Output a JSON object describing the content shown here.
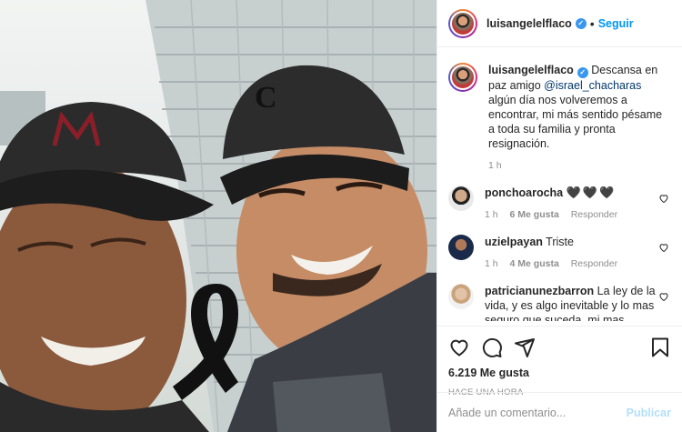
{
  "header": {
    "username": "luisangelelflaco",
    "dot": "•",
    "follow_label": "Seguir",
    "more_label": "···"
  },
  "caption": {
    "username": "luisangelelflaco",
    "text_before": "Descansa en paz amigo ",
    "mention": "@israel_chacharas",
    "text_after": " algún día nos volveremos a encontrar, mi más sentido pésame a toda su familia y pronta resignación.",
    "time": "1 h"
  },
  "comments": [
    {
      "username": "ponchoarocha",
      "text": "🖤🖤🖤",
      "time": "1 h",
      "likes": "6 Me gusta",
      "reply": "Responder"
    },
    {
      "username": "uzielpayan",
      "text": "Triste",
      "time": "1 h",
      "likes": "4 Me gusta",
      "reply": "Responder"
    },
    {
      "username": "patricianunezbarron",
      "text": "La ley de la vida, y es algo inevitable y lo mas seguro que suceda, mi mas sentido pésame a la familia"
    }
  ],
  "stats": {
    "likes": "6.219 Me gusta",
    "posted": "Hace una hora"
  },
  "composer": {
    "placeholder": "Añade un comentario...",
    "publish_label": "Publicar"
  },
  "icons": [
    "heart-icon",
    "comment-icon",
    "share-icon",
    "save-icon",
    "verified-badge-icon",
    "more-icon"
  ],
  "colors": {
    "link_blue": "#0095f6",
    "mention": "#00376b",
    "muted": "#8e8e8e",
    "publish_disabled": "#b2dffc",
    "verified": "#3897f0"
  }
}
